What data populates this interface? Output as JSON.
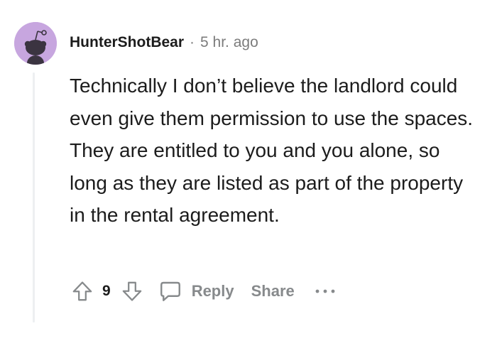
{
  "comment": {
    "username": "HunterShotBear",
    "separator": "·",
    "timestamp": "5 hr. ago",
    "body": "Technically I don’t believe the landlord could even give them permission to use the spaces. They are entitled to you and you alone, so long as they are listed as part of the property in the rental agreement.",
    "score": "9",
    "reply_label": "Reply",
    "share_label": "Share"
  },
  "icons": {
    "avatar": "snoo-avatar-icon",
    "upvote": "upvote-arrow-icon",
    "downvote": "downvote-arrow-icon",
    "reply": "comment-bubble-icon",
    "more": "more-dots-icon"
  },
  "colors": {
    "avatar_bg": "#c7a6df",
    "text": "#1c1c1c",
    "muted": "#7c7c7c",
    "action": "#878a8c",
    "thread_line": "#edeff1"
  }
}
